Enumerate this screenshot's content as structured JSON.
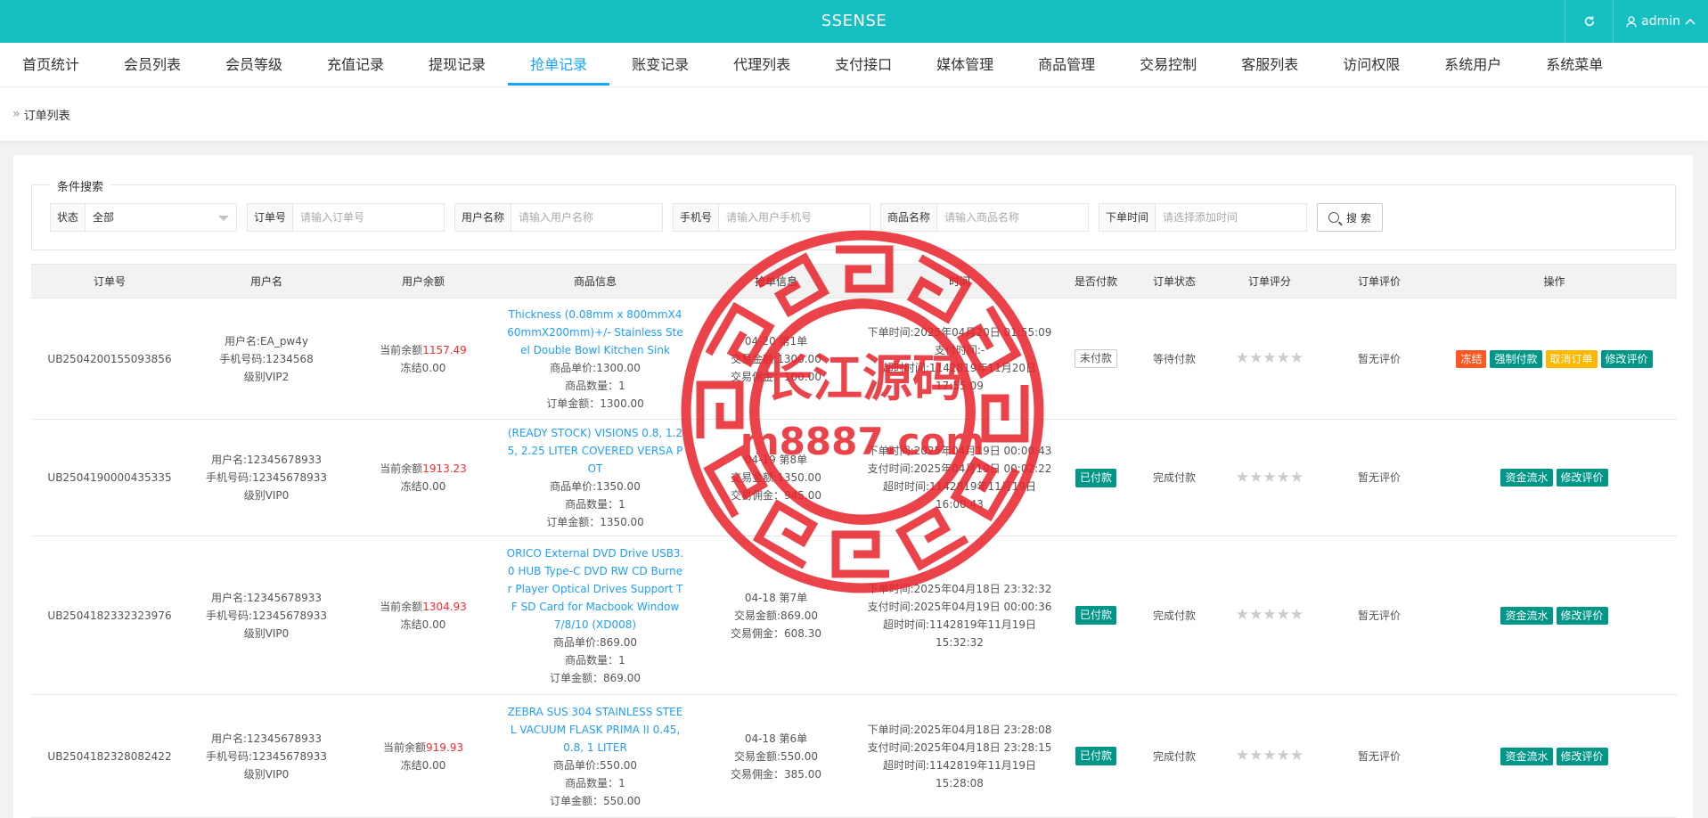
{
  "app": {
    "title": "SSENSE",
    "user": "admin"
  },
  "nav": [
    {
      "label": "首页统计"
    },
    {
      "label": "会员列表"
    },
    {
      "label": "会员等级"
    },
    {
      "label": "充值记录"
    },
    {
      "label": "提现记录"
    },
    {
      "label": "抢单记录",
      "active": true
    },
    {
      "label": "账变记录"
    },
    {
      "label": "代理列表"
    },
    {
      "label": "支付接口"
    },
    {
      "label": "媒体管理"
    },
    {
      "label": "商品管理"
    },
    {
      "label": "交易控制"
    },
    {
      "label": "客服列表"
    },
    {
      "label": "访问权限"
    },
    {
      "label": "系统用户"
    },
    {
      "label": "系统菜单"
    }
  ],
  "breadcrumb": "订单列表",
  "search": {
    "legend": "条件搜索",
    "status_label": "状态",
    "status_value": "全部",
    "order_label": "订单号",
    "order_placeholder": "请输入订单号",
    "username_label": "用户名称",
    "username_placeholder": "请输入用户名称",
    "phone_label": "手机号",
    "phone_placeholder": "请输入用户手机号",
    "product_label": "商品名称",
    "product_placeholder": "请输入商品名称",
    "time_label": "下单时间",
    "time_placeholder": "请选择添加时间",
    "button": "搜 索"
  },
  "table": {
    "headers": [
      "订单号",
      "用户名",
      "用户余额",
      "商品信息",
      "抢单信息",
      "时间",
      "是否付款",
      "订单状态",
      "订单评分",
      "订单评价",
      "操作"
    ],
    "rows": [
      {
        "order_no": "UB2504200155093856",
        "user": [
          "用户名:EA_pw4y",
          "手机号码:1234568",
          "级别VIP2"
        ],
        "balance_prefix": "当前余额",
        "balance": "1157.49",
        "frozen": "冻结0.00",
        "product": "Thickness (0.08mm x 800mmX460mmX200mm)+/- Stainless Steel Double Bowl Kitchen Sink",
        "price": "商品单价:1300.00",
        "qty": "商品数量：1",
        "amount": "订单金额：1300.00",
        "grab": [
          "04-20 第1单",
          "交易金额:1300.00",
          "交易佣金：100.00"
        ],
        "time": [
          "下单时间:2025年04月20日 01:55:09",
          "支付时间:-",
          "超时时间:1142819年11月20日 17:55:09"
        ],
        "paid": "未付款",
        "paid_state": "unpaid",
        "status": "等待付款",
        "stars": "★★★★★",
        "review": "暂无评价",
        "actions": [
          {
            "label": "冻结",
            "color": "orange"
          },
          {
            "label": "强制付款",
            "color": "teal"
          },
          {
            "label": "取消订单",
            "color": "yellow"
          },
          {
            "label": "修改评价",
            "color": "teal"
          }
        ]
      },
      {
        "order_no": "UB2504190000435335",
        "user": [
          "用户名:12345678933",
          "手机号码:12345678933",
          "级别VIP0"
        ],
        "balance_prefix": "当前余额",
        "balance": "1913.23",
        "frozen": "冻结0.00",
        "product": "(READY STOCK) VISIONS 0.8, 1.25, 2.25 LITER COVERED VERSA POT",
        "price": "商品单价:1350.00",
        "qty": "商品数量：1",
        "amount": "订单金额：1350.00",
        "grab": [
          "04-19 第8单",
          "交易金额:1350.00",
          "交易佣金：945.00"
        ],
        "time": [
          "下单时间:2025年04月19日 00:00:43",
          "支付时间:2025年04月19日 00:02:22",
          "超时时间:1142819年11月19日 16:00:43"
        ],
        "paid": "已付款",
        "paid_state": "paid",
        "status": "完成付款",
        "stars": "★★★★★",
        "review": "暂无评价",
        "actions": [
          {
            "label": "资金流水",
            "color": "teal"
          },
          {
            "label": "修改评价",
            "color": "teal"
          }
        ]
      },
      {
        "order_no": "UB2504182332323976",
        "user": [
          "用户名:12345678933",
          "手机号码:12345678933",
          "级别VIP0"
        ],
        "balance_prefix": "当前余额",
        "balance": "1304.93",
        "frozen": "冻结0.00",
        "product": "ORICO External DVD Drive USB3.0 HUB Type-C DVD RW CD Burner Player Optical Drives Support TF SD Card for Macbook Window 7/8/10 (XD008)",
        "price": "商品单价:869.00",
        "qty": "商品数量：1",
        "amount": "订单金额：869.00",
        "grab": [
          "04-18 第7单",
          "交易金额:869.00",
          "交易佣金：608.30"
        ],
        "time": [
          "下单时间:2025年04月18日 23:32:32",
          "支付时间:2025年04月19日 00:00:36",
          "超时时间:1142819年11月19日 15:32:32"
        ],
        "paid": "已付款",
        "paid_state": "paid",
        "status": "完成付款",
        "stars": "★★★★★",
        "review": "暂无评价",
        "actions": [
          {
            "label": "资金流水",
            "color": "teal"
          },
          {
            "label": "修改评价",
            "color": "teal"
          }
        ]
      },
      {
        "order_no": "UB2504182328082422",
        "user": [
          "用户名:12345678933",
          "手机号码:12345678933",
          "级别VIP0"
        ],
        "balance_prefix": "当前余额",
        "balance": "919.93",
        "frozen": "冻结0.00",
        "product": "ZEBRA SUS 304 STAINLESS STEEL VACUUM FLASK PRIMA II 0.45, 0.8, 1 LITER",
        "price": "商品单价:550.00",
        "qty": "商品数量：1",
        "amount": "订单金额：550.00",
        "grab": [
          "04-18 第6单",
          "交易金额:550.00",
          "交易佣金：385.00"
        ],
        "time": [
          "下单时间:2025年04月18日 23:28:08",
          "支付时间:2025年04月18日 23:28:15",
          "超时时间:1142819年11月19日 15:28:08"
        ],
        "paid": "已付款",
        "paid_state": "paid",
        "status": "完成付款",
        "stars": "★★★★★",
        "review": "暂无评价",
        "actions": [
          {
            "label": "资金流水",
            "color": "teal"
          },
          {
            "label": "修改评价",
            "color": "teal"
          }
        ]
      }
    ]
  },
  "watermark": {
    "text1": "长江源码",
    "text2": "m8887.com",
    "color": "#e8232a"
  }
}
